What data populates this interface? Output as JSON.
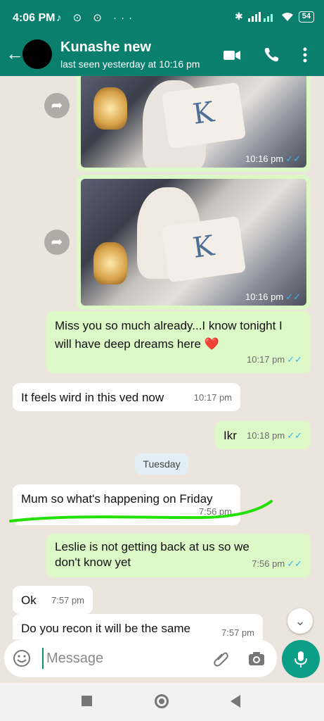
{
  "status_bar": {
    "time": "4:06 PM",
    "icons": "♪ ⊙ ⊙ ···",
    "battery": "54"
  },
  "header": {
    "name": "Kunashe new",
    "status": "last seen yesterday at 10:16 pm"
  },
  "messages": {
    "img1_time": "10:16 pm",
    "img2_time": "10:16 pm",
    "img_letter": "K",
    "m1_text": "Miss you so much already...I know tonight I will have deep dreams here ❤️",
    "m1_time": "10:17 pm",
    "m2_text": "It feels wird in this ved now",
    "m2_time": "10:17 pm",
    "m3_text": "Ikr",
    "m3_time": "10:18 pm",
    "date_chip": "Tuesday",
    "m4_text": "Mum so what's happening on Friday",
    "m4_time": "7:56 pm",
    "m5_text": "Leslie is not getting back at us so we don't know yet",
    "m5_time": "7:56 pm",
    "m6_text": "Ok",
    "m6_time": "7:57 pm",
    "m7_text": "Do you recon it will be the same",
    "m7_time": "7:57 pm",
    "ticks": "✓✓"
  },
  "composer": {
    "placeholder": "Message"
  },
  "icons": {
    "back": "arrow-left",
    "video": "video-camera",
    "call": "phone",
    "menu": "more-vertical",
    "forward": "share-arrow",
    "emoji": "smiley",
    "attach": "paperclip",
    "camera": "camera",
    "mic": "microphone",
    "scroll": "double-chevron-down"
  },
  "colors": {
    "header": "#0a7f6e",
    "outgoing": "#dcf8c6",
    "incoming": "#ffffff",
    "tick_blue": "#34b7f1",
    "highlight": "#22e000",
    "fab": "#0a9f86"
  }
}
